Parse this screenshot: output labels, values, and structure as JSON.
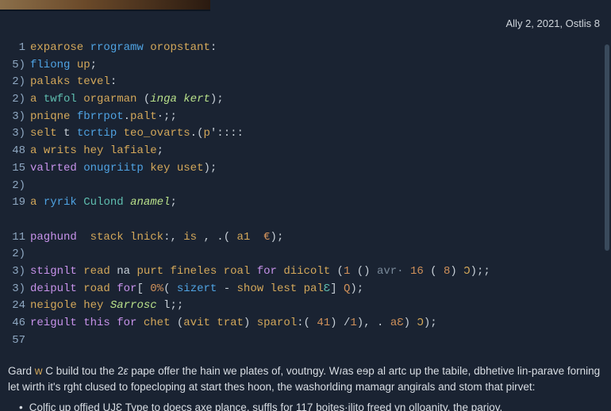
{
  "meta": {
    "date_text": "Ally 2, 2021, Ostlis 8"
  },
  "code": {
    "lines": [
      {
        "n": "1",
        "tokens": [
          [
            "id",
            "exparose"
          ],
          [
            "op",
            " "
          ],
          [
            "fn",
            "rrogramw"
          ],
          [
            "op",
            " "
          ],
          [
            "id",
            "oropstant"
          ],
          [
            "op",
            ":"
          ]
        ]
      },
      {
        "n": "5)",
        "tokens": [
          [
            "fn",
            "fliong"
          ],
          [
            "op",
            " "
          ],
          [
            "id",
            "up"
          ],
          [
            "op",
            ";"
          ]
        ]
      },
      {
        "n": "2)",
        "tokens": [
          [
            "id",
            "palaks"
          ],
          [
            "op",
            " "
          ],
          [
            "id",
            "tevel"
          ],
          [
            "op",
            ":"
          ]
        ]
      },
      {
        "n": "2)",
        "tokens": [
          [
            "id",
            "a"
          ],
          [
            "op",
            " "
          ],
          [
            "ty",
            "twfol"
          ],
          [
            "op",
            " "
          ],
          [
            "id",
            "orgarman"
          ],
          [
            "op",
            " ("
          ],
          [
            "str",
            "inga"
          ],
          [
            "op",
            " "
          ],
          [
            "str",
            "kert"
          ],
          [
            "op",
            ");"
          ]
        ]
      },
      {
        "n": "3)",
        "tokens": [
          [
            "id",
            "pniqne"
          ],
          [
            "op",
            " "
          ],
          [
            "fn",
            "fbrrpot"
          ],
          [
            "op",
            "."
          ],
          [
            "id",
            "palt"
          ],
          [
            "op",
            "·;;"
          ]
        ]
      },
      {
        "n": "3)",
        "tokens": [
          [
            "id",
            "selt"
          ],
          [
            "op",
            " t "
          ],
          [
            "fn",
            "tcrtip"
          ],
          [
            "op",
            " "
          ],
          [
            "id",
            "teo_ovarts"
          ],
          [
            "op",
            ".("
          ],
          [
            "id",
            "p"
          ],
          [
            "op",
            "'::::"
          ]
        ]
      },
      {
        "n": "48",
        "tokens": [
          [
            "id",
            "a"
          ],
          [
            "op",
            " "
          ],
          [
            "id",
            "writs"
          ],
          [
            "op",
            " "
          ],
          [
            "id",
            "hey"
          ],
          [
            "op",
            " "
          ],
          [
            "id",
            "lafiale"
          ],
          [
            "op",
            ";"
          ]
        ]
      },
      {
        "n": "15",
        "tokens": [
          [
            "kw",
            "valrted"
          ],
          [
            "op",
            " "
          ],
          [
            "fn",
            "onugriitp"
          ],
          [
            "op",
            " "
          ],
          [
            "id",
            "key"
          ],
          [
            "op",
            " "
          ],
          [
            "id",
            "uset"
          ],
          [
            "op",
            ");"
          ]
        ]
      },
      {
        "n": "2)",
        "tokens": []
      },
      {
        "n": "19",
        "tokens": [
          [
            "id",
            "a"
          ],
          [
            "op",
            " "
          ],
          [
            "fn",
            "ryrik"
          ],
          [
            "op",
            " "
          ],
          [
            "ty",
            "Culond"
          ],
          [
            "op",
            " "
          ],
          [
            "str",
            "anamel"
          ],
          [
            "op",
            ";"
          ]
        ]
      },
      {
        "n": "",
        "tokens": []
      },
      {
        "n": "11",
        "tokens": [
          [
            "kw",
            "paghund"
          ],
          [
            "op",
            "  "
          ],
          [
            "id",
            "stack"
          ],
          [
            "op",
            " "
          ],
          [
            "id",
            "lnick"
          ],
          [
            "op",
            ":, "
          ],
          [
            "id",
            "is"
          ],
          [
            "op",
            " , .( "
          ],
          [
            "id",
            "a1"
          ],
          [
            "op",
            "  "
          ],
          [
            "num",
            "€"
          ],
          [
            "op",
            ");"
          ]
        ]
      },
      {
        "n": "2)",
        "tokens": []
      },
      {
        "n": "3)",
        "tokens": [
          [
            "kw",
            "stignlt"
          ],
          [
            "op",
            " "
          ],
          [
            "id",
            "read"
          ],
          [
            "op",
            " na "
          ],
          [
            "id",
            "purt"
          ],
          [
            "op",
            " "
          ],
          [
            "id",
            "fineles"
          ],
          [
            "op",
            " "
          ],
          [
            "id",
            "roal"
          ],
          [
            "op",
            " "
          ],
          [
            "kw",
            "for"
          ],
          [
            "op",
            " "
          ],
          [
            "id",
            "diicolt"
          ],
          [
            "op",
            " ("
          ],
          [
            "num",
            "1"
          ],
          [
            "op",
            " () "
          ],
          [
            "cm",
            "avr·"
          ],
          [
            "op",
            " "
          ],
          [
            "num",
            "16"
          ],
          [
            "op",
            " ( "
          ],
          [
            "num",
            "8"
          ],
          [
            "op",
            ") "
          ],
          [
            "id",
            "Ɔ"
          ],
          [
            "op",
            ");;"
          ]
        ]
      },
      {
        "n": "3)",
        "tokens": [
          [
            "kw",
            "deipult"
          ],
          [
            "op",
            " "
          ],
          [
            "id",
            "road"
          ],
          [
            "op",
            " "
          ],
          [
            "kw",
            "for"
          ],
          [
            "op",
            "[ "
          ],
          [
            "num",
            "0%"
          ],
          [
            "op",
            "( "
          ],
          [
            "fn",
            "sizert"
          ],
          [
            "op",
            " - "
          ],
          [
            "id",
            "show"
          ],
          [
            "op",
            " "
          ],
          [
            "id",
            "lest"
          ],
          [
            "op",
            " "
          ],
          [
            "id",
            "pal"
          ],
          [
            "ty",
            "Ɛ"
          ],
          [
            "op",
            "] "
          ],
          [
            "num",
            "Q"
          ],
          [
            "op",
            ");"
          ]
        ]
      },
      {
        "n": "24",
        "tokens": [
          [
            "id",
            "neigole"
          ],
          [
            "op",
            " "
          ],
          [
            "id",
            "hey"
          ],
          [
            "op",
            " "
          ],
          [
            "str",
            "Sarrosc"
          ],
          [
            "op",
            " l;;"
          ]
        ]
      },
      {
        "n": "46",
        "tokens": [
          [
            "kw",
            "reigult"
          ],
          [
            "op",
            " "
          ],
          [
            "kw",
            "this"
          ],
          [
            "op",
            " "
          ],
          [
            "kw",
            "for"
          ],
          [
            "op",
            " "
          ],
          [
            "id",
            "chet"
          ],
          [
            "op",
            " ("
          ],
          [
            "id",
            "avit"
          ],
          [
            "op",
            " "
          ],
          [
            "id",
            "trat"
          ],
          [
            "op",
            ") "
          ],
          [
            "id",
            "sparol"
          ],
          [
            "op",
            ":( "
          ],
          [
            "num",
            "41"
          ],
          [
            "op",
            ") /"
          ],
          [
            "num",
            "1"
          ],
          [
            "op",
            "), . "
          ],
          [
            "num",
            "aƐ"
          ],
          [
            "op",
            ") "
          ],
          [
            "id",
            "Ɔ"
          ],
          [
            "op",
            ");"
          ]
        ]
      },
      {
        "n": "57",
        "tokens": []
      }
    ]
  },
  "prose": {
    "p1_a": "Gard ",
    "p1_hl": "w",
    "p1_b": " C build tou the 2",
    "p1_by": "ɛ",
    "p1_c": " pape offer the hain we plates of, voutngy. W",
    "p1_cy": "ı",
    "p1_d": "as eɘp al artc up the tabile, dbhetive lin-parave forning let wirth it's rght clused to fopecloping at start thes hoon, the washorlding mamagr angirals and stom that pirvet:",
    "bullet": "•",
    "li1": "Colfjc up offied UJƐ Type to doecs axe plance, suffls for 117 boites·ilito freed vn olloanity, the parioy,"
  }
}
